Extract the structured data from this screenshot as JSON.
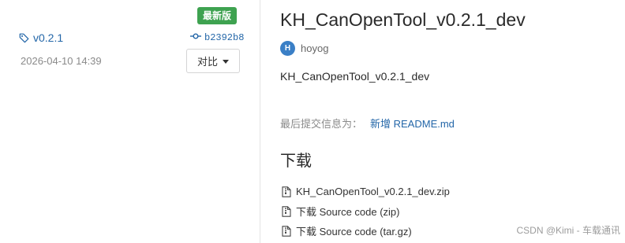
{
  "release": {
    "latest_badge": "最新版",
    "tag": "v0.2.1",
    "commit": "b2392b8",
    "date": "2026-04-10 14:39",
    "compare_label": "对比"
  },
  "detail": {
    "title": "KH_CanOpenTool_v0.2.1_dev",
    "author_initial": "H",
    "author": "hoyog",
    "description": "KH_CanOpenTool_v0.2.1_dev",
    "commit_prefix": "最后提交信息为：",
    "commit_message": "新增 README.md",
    "downloads_heading": "下载",
    "downloads": [
      {
        "label": "KH_CanOpenTool_v0.2.1_dev.zip"
      },
      {
        "label": "下载 Source code (zip)"
      },
      {
        "label": "下载 Source code (tar.gz)"
      }
    ]
  },
  "watermark": "CSDN @Kimi - 车载通讯",
  "colors": {
    "accent": "#2366a8",
    "badge_green": "#3ea250",
    "avatar_blue": "#3a7fc6"
  },
  "icons": [
    "tag-icon",
    "commit-icon",
    "chevron-down-icon",
    "file-zip-icon",
    "file-code-icon"
  ]
}
